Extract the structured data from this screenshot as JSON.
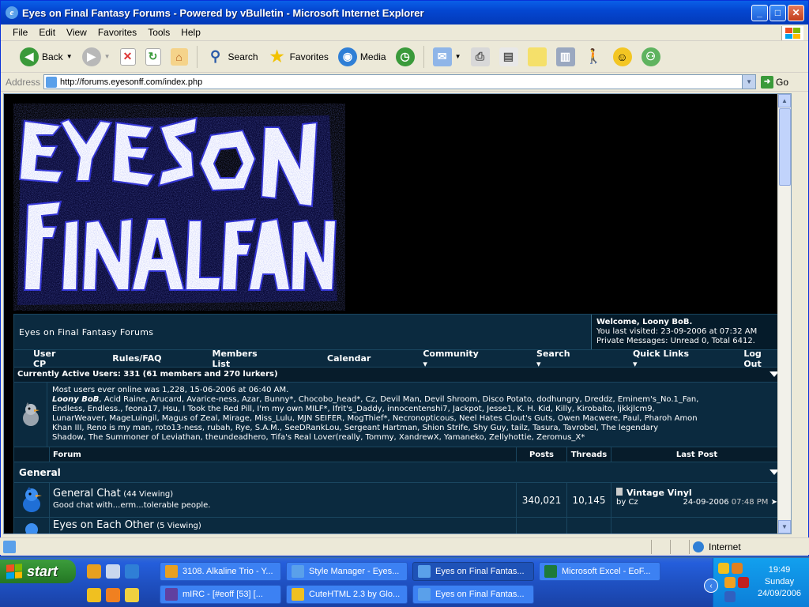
{
  "window": {
    "title": "Eyes on Final Fantasy Forums - Powered by vBulletin - Microsoft Internet Explorer",
    "buttons": {
      "minimize": "_",
      "maximize": "□",
      "close": "✕"
    }
  },
  "menu": [
    "File",
    "Edit",
    "View",
    "Favorites",
    "Tools",
    "Help"
  ],
  "toolbar": {
    "back": "Back",
    "search": "Search",
    "favorites": "Favorites",
    "media": "Media"
  },
  "address": {
    "label": "Address",
    "url": "http://forums.eyesonff.com/index.php",
    "go": "Go"
  },
  "logo": {
    "alt_line1": "EYES ON",
    "alt_line2": "FINAL FANTASY"
  },
  "forum": {
    "site_title": "Eyes on Final Fantasy Forums",
    "welcome": "Welcome, Loony BoB.",
    "last_visited": "You last visited: 23-09-2006 at 07:32 AM",
    "pm": "Private Messages: Unread 0, Total 6412.",
    "nav": [
      "User CP",
      "Rules/FAQ",
      "Members List",
      "Calendar",
      "Community ▾",
      "Search ▾",
      "Quick Links ▾",
      "Log Out"
    ],
    "active_users_header": "Currently Active Users: 331 (61 members and 270 lurkers)",
    "most_online": "Most users ever online was 1,228, 15-06-2006 at 06:40 AM.",
    "users_line1_bold": "Loony BoB",
    "users_line1": ", Acid Raine, Arucard, Avarice-ness, Azar, Bunny*, Chocobo_head*, Cz, Devil Man, Devil Shroom, Disco Potato, dodhungry, Dreddz, Eminem's_No.1_Fan,",
    "users_line2": "Endless, Endless., feona17, Hsu, I Took the Red Pill, I'm my own MILF*, Ifrit's_Daddy, innocentenshi7, Jackpot, Jesse1, K. H. Kid, Killy, Kirobaito, ljkkjlcm9,",
    "users_line3": "LunarWeaver, MageLuingil, Magus of Zeal, Mirage, Miss_Lulu, MJN SEIFER, MogThief*, Necronopticous, Neel Hates Clout's Guts, Owen Macwere, Paul, Pharoh Amon",
    "users_line4": "Khan III, Reno is my man, roto13-ness, rubah, Rye, S.A.M., SeeDRankLou, Sergeant Hartman, Shion Strife, Shy Guy, tailz, Tasura, Tavrobel, The legendary",
    "users_line5": "Shadow, The Summoner of Leviathan, theundeadhero, Tifa's Real Lover(really, Tommy, XandrewX, Yamaneko, Zellyhottie, Zeromus_X*",
    "columns": [
      "Forum",
      "Posts",
      "Threads",
      "Last Post"
    ],
    "category": "General",
    "forums": [
      {
        "name": "General Chat",
        "viewing": "(44 Viewing)",
        "desc": "Good chat with...erm...tolerable people.",
        "posts": "340,021",
        "threads": "10,145",
        "last_title": "Vintage Vinyl",
        "last_by": "by Cz",
        "last_date": "24-09-2006",
        "last_time": "07:48 PM"
      },
      {
        "name": "Eyes on Each Other",
        "viewing": "(5 Viewing)",
        "desc": "",
        "posts": "",
        "threads": "",
        "last_title": "",
        "last_by": "",
        "last_date": "",
        "last_time": ""
      }
    ]
  },
  "status": {
    "zone": "Internet"
  },
  "taskbar": {
    "start": "start",
    "tasks_row1": [
      "3108. Alkaline Trio - Y...",
      "Style Manager - Eyes...",
      "Eyes on Final Fantas...",
      "Microsoft Excel - EoF..."
    ],
    "tasks_row2": [
      "mIRC - [#eoff [53] [...",
      "CuteHTML 2.3 by Glo...",
      "Eyes on Final Fantas..."
    ],
    "clock_time": "19:49",
    "clock_day": "Sunday",
    "clock_date": "24/09/2006"
  },
  "colors": {
    "xp_blue": "#0447d1",
    "forum_bg": "#0b2a3f",
    "forum_dark": "#071c2b",
    "taskbar": "#245edb"
  }
}
